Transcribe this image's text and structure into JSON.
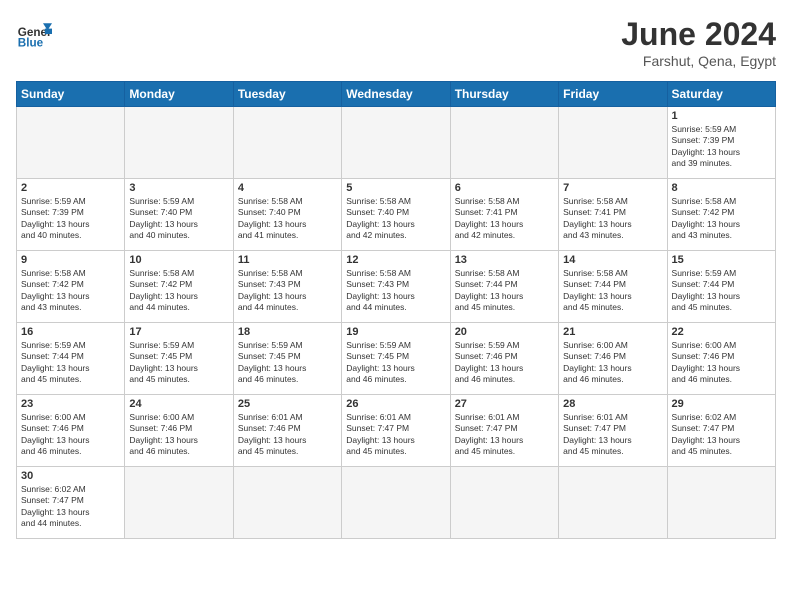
{
  "header": {
    "logo_general": "General",
    "logo_blue": "Blue",
    "month_title": "June 2024",
    "subtitle": "Farshut, Qena, Egypt"
  },
  "weekdays": [
    "Sunday",
    "Monday",
    "Tuesday",
    "Wednesday",
    "Thursday",
    "Friday",
    "Saturday"
  ],
  "days": [
    {
      "num": "",
      "info": ""
    },
    {
      "num": "",
      "info": ""
    },
    {
      "num": "",
      "info": ""
    },
    {
      "num": "",
      "info": ""
    },
    {
      "num": "",
      "info": ""
    },
    {
      "num": "",
      "info": ""
    },
    {
      "num": "1",
      "info": "Sunrise: 5:59 AM\nSunset: 7:39 PM\nDaylight: 13 hours\nand 39 minutes."
    },
    {
      "num": "2",
      "info": "Sunrise: 5:59 AM\nSunset: 7:39 PM\nDaylight: 13 hours\nand 40 minutes."
    },
    {
      "num": "3",
      "info": "Sunrise: 5:59 AM\nSunset: 7:40 PM\nDaylight: 13 hours\nand 40 minutes."
    },
    {
      "num": "4",
      "info": "Sunrise: 5:58 AM\nSunset: 7:40 PM\nDaylight: 13 hours\nand 41 minutes."
    },
    {
      "num": "5",
      "info": "Sunrise: 5:58 AM\nSunset: 7:40 PM\nDaylight: 13 hours\nand 42 minutes."
    },
    {
      "num": "6",
      "info": "Sunrise: 5:58 AM\nSunset: 7:41 PM\nDaylight: 13 hours\nand 42 minutes."
    },
    {
      "num": "7",
      "info": "Sunrise: 5:58 AM\nSunset: 7:41 PM\nDaylight: 13 hours\nand 43 minutes."
    },
    {
      "num": "8",
      "info": "Sunrise: 5:58 AM\nSunset: 7:42 PM\nDaylight: 13 hours\nand 43 minutes."
    },
    {
      "num": "9",
      "info": "Sunrise: 5:58 AM\nSunset: 7:42 PM\nDaylight: 13 hours\nand 43 minutes."
    },
    {
      "num": "10",
      "info": "Sunrise: 5:58 AM\nSunset: 7:42 PM\nDaylight: 13 hours\nand 44 minutes."
    },
    {
      "num": "11",
      "info": "Sunrise: 5:58 AM\nSunset: 7:43 PM\nDaylight: 13 hours\nand 44 minutes."
    },
    {
      "num": "12",
      "info": "Sunrise: 5:58 AM\nSunset: 7:43 PM\nDaylight: 13 hours\nand 44 minutes."
    },
    {
      "num": "13",
      "info": "Sunrise: 5:58 AM\nSunset: 7:44 PM\nDaylight: 13 hours\nand 45 minutes."
    },
    {
      "num": "14",
      "info": "Sunrise: 5:58 AM\nSunset: 7:44 PM\nDaylight: 13 hours\nand 45 minutes."
    },
    {
      "num": "15",
      "info": "Sunrise: 5:59 AM\nSunset: 7:44 PM\nDaylight: 13 hours\nand 45 minutes."
    },
    {
      "num": "16",
      "info": "Sunrise: 5:59 AM\nSunset: 7:44 PM\nDaylight: 13 hours\nand 45 minutes."
    },
    {
      "num": "17",
      "info": "Sunrise: 5:59 AM\nSunset: 7:45 PM\nDaylight: 13 hours\nand 45 minutes."
    },
    {
      "num": "18",
      "info": "Sunrise: 5:59 AM\nSunset: 7:45 PM\nDaylight: 13 hours\nand 46 minutes."
    },
    {
      "num": "19",
      "info": "Sunrise: 5:59 AM\nSunset: 7:45 PM\nDaylight: 13 hours\nand 46 minutes."
    },
    {
      "num": "20",
      "info": "Sunrise: 5:59 AM\nSunset: 7:46 PM\nDaylight: 13 hours\nand 46 minutes."
    },
    {
      "num": "21",
      "info": "Sunrise: 6:00 AM\nSunset: 7:46 PM\nDaylight: 13 hours\nand 46 minutes."
    },
    {
      "num": "22",
      "info": "Sunrise: 6:00 AM\nSunset: 7:46 PM\nDaylight: 13 hours\nand 46 minutes."
    },
    {
      "num": "23",
      "info": "Sunrise: 6:00 AM\nSunset: 7:46 PM\nDaylight: 13 hours\nand 46 minutes."
    },
    {
      "num": "24",
      "info": "Sunrise: 6:00 AM\nSunset: 7:46 PM\nDaylight: 13 hours\nand 46 minutes."
    },
    {
      "num": "25",
      "info": "Sunrise: 6:01 AM\nSunset: 7:46 PM\nDaylight: 13 hours\nand 45 minutes."
    },
    {
      "num": "26",
      "info": "Sunrise: 6:01 AM\nSunset: 7:47 PM\nDaylight: 13 hours\nand 45 minutes."
    },
    {
      "num": "27",
      "info": "Sunrise: 6:01 AM\nSunset: 7:47 PM\nDaylight: 13 hours\nand 45 minutes."
    },
    {
      "num": "28",
      "info": "Sunrise: 6:01 AM\nSunset: 7:47 PM\nDaylight: 13 hours\nand 45 minutes."
    },
    {
      "num": "29",
      "info": "Sunrise: 6:02 AM\nSunset: 7:47 PM\nDaylight: 13 hours\nand 45 minutes."
    },
    {
      "num": "30",
      "info": "Sunrise: 6:02 AM\nSunset: 7:47 PM\nDaylight: 13 hours\nand 44 minutes."
    }
  ]
}
